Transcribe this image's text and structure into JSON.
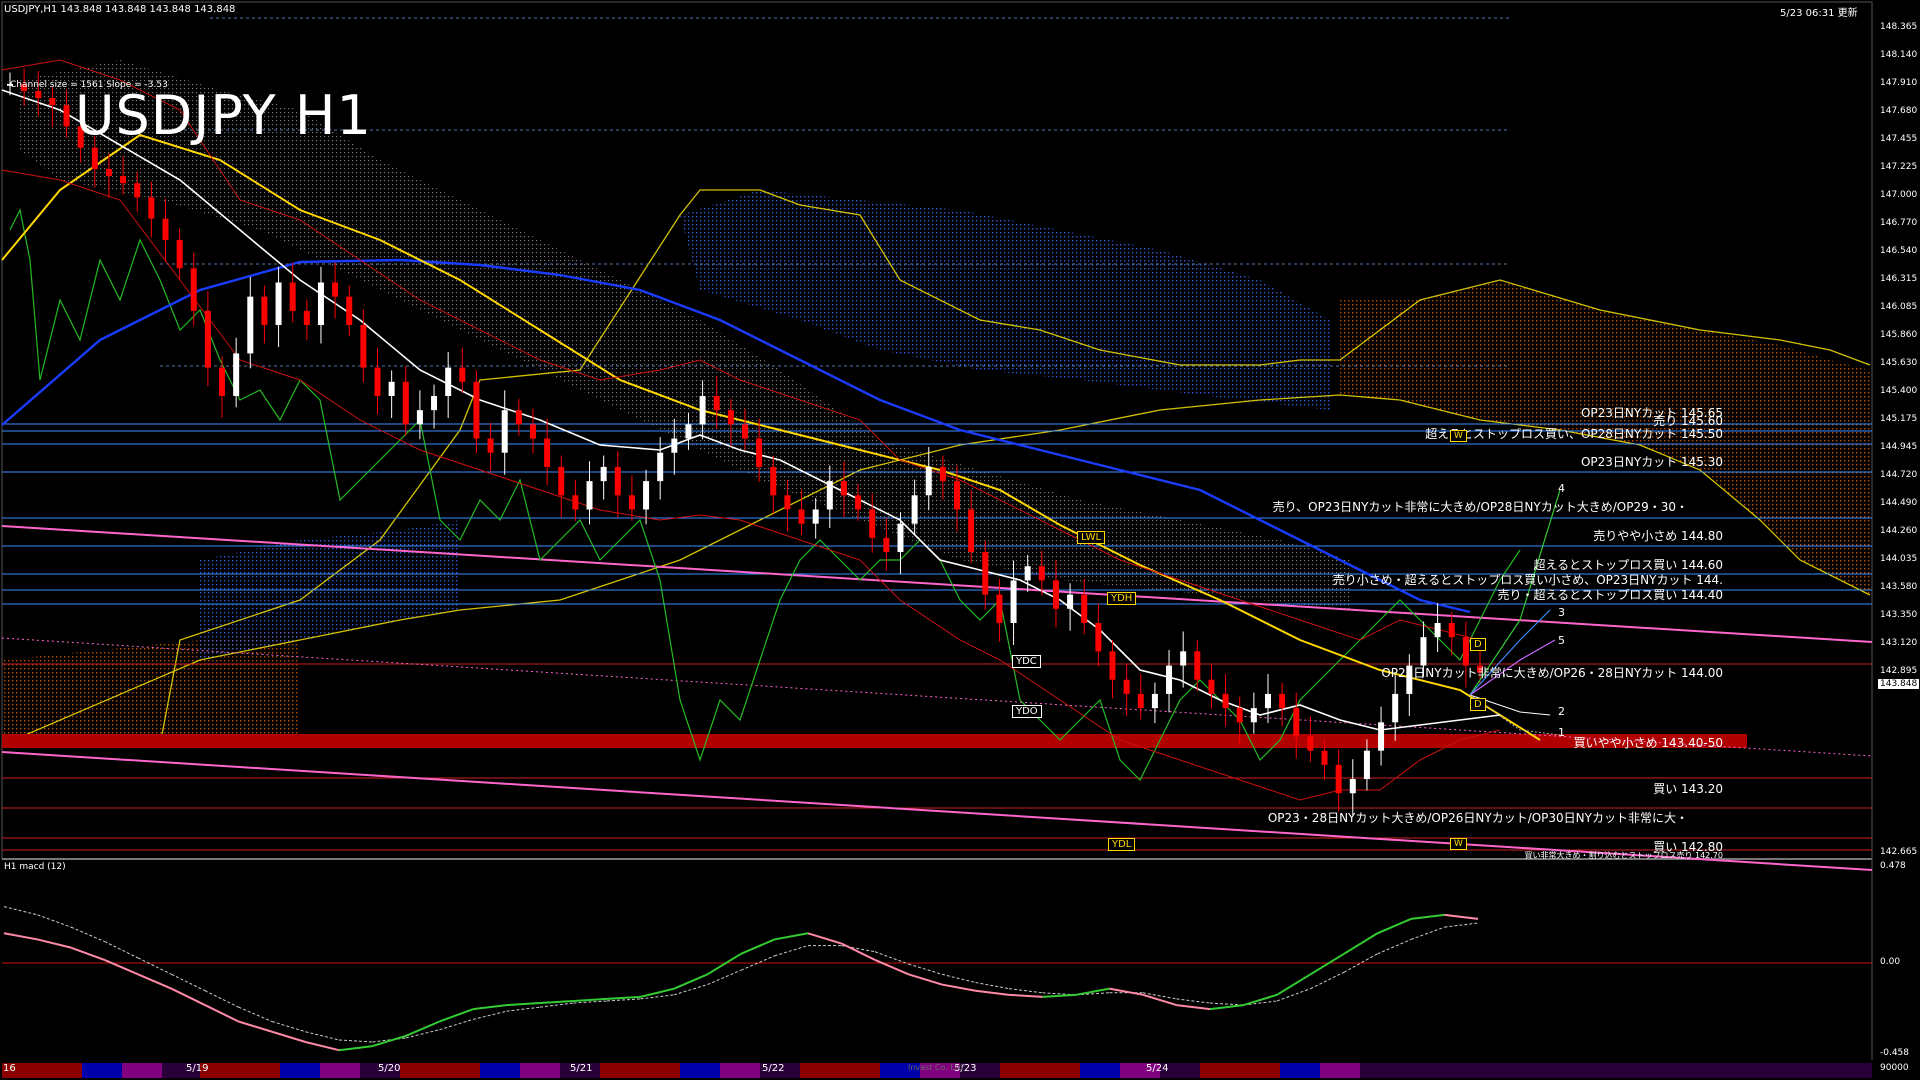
{
  "header": {
    "symbol_info": "USDJPY,H1  143.848 143.848 143.848 143.848",
    "channel_info": "Channel size = 1561 Slope = -3.53",
    "timestamp": "5/23 06:31 更新"
  },
  "title": "USDJPY H1",
  "price_scale": [
    "148.365",
    "148.140",
    "147.910",
    "147.680",
    "147.455",
    "147.225",
    "147.000",
    "146.770",
    "146.540",
    "146.315",
    "146.085",
    "145.860",
    "145.630",
    "145.400",
    "145.175",
    "144.945",
    "144.720",
    "144.490",
    "144.260",
    "144.035",
    "143.580",
    "143.350",
    "143.120",
    "142.895",
    "142.665"
  ],
  "current_price": "143.848",
  "order_labels": [
    "OP23日NYカット 145.65",
    "売り 145.60",
    "超えるとストップロス買い、OP28日NYカット 145.50",
    "OP23日NYカット 145.30",
    "売り、OP23日NYカット非常に大きめ/OP28日NYカット大きめ/OP29・30・",
    "売りやや小さめ 144.80",
    "超えるとストップロス買い 144.60",
    "売り小さめ・超えるとストップロス買い小さめ、OP23日NYカット 144.",
    "売り・超えるとストップロス買い 144.40",
    "OP23日NYカット非常に大きめ/OP26・28日NYカット 144.00",
    "買いやや小さめ 143.40-50",
    "買い 143.20",
    "OP23・28日NYカット大きめ/OP26日NYカット/OP30日NYカット非常に大・",
    "買い 142.80",
    "買い非常大きめ・割り込むとストップロス売り 142.70"
  ],
  "tags": {
    "lwl": "LWL",
    "ydh": "YDH",
    "ydc": "YDC",
    "ydo": "YDO",
    "ydl": "YDL",
    "w1": "W",
    "w2": "W",
    "d1": "D",
    "d2": "D"
  },
  "wave_labels": [
    "4",
    "3",
    "5",
    "2",
    "1"
  ],
  "macd": {
    "label": "H1  macd (12)",
    "scale": [
      "0.478",
      "0.00",
      "-0.458"
    ]
  },
  "date_axis": {
    "left_label": "16",
    "dates": [
      "5/19",
      "5/20",
      "5/21",
      "5/22",
      "5/23",
      "5/24"
    ],
    "right_label": "90000",
    "watermark": "Invast Co. Ltd"
  },
  "colors": {
    "bull_candle": "#ffffff",
    "bear_candle": "#ff0000",
    "ma_white": "#ffffff",
    "ma_yellow": "#ffd700",
    "ma_blue": "#1a3cff",
    "channel": "#ff66cc",
    "cloud_bull": "#4169e1",
    "cloud_bear": "#ff4500",
    "macd_line": "#33cc33",
    "signal_line": "#cccccc",
    "macd_neg": "#ff8aa8"
  },
  "chart_data": {
    "type": "candlestick",
    "title": "USDJPY H1",
    "ylim": [
      142.6,
      148.45
    ],
    "close_series": [
      148.0,
      147.95,
      147.9,
      147.85,
      147.7,
      147.55,
      147.4,
      147.35,
      147.3,
      147.2,
      147.05,
      146.9,
      146.7,
      146.4,
      146.0,
      145.8,
      146.1,
      146.5,
      146.3,
      146.6,
      146.4,
      146.3,
      146.6,
      146.5,
      146.3,
      146.0,
      145.8,
      145.9,
      145.6,
      145.7,
      145.8,
      146.0,
      145.9,
      145.5,
      145.4,
      145.7,
      145.6,
      145.5,
      145.3,
      145.1,
      145.0,
      145.2,
      145.3,
      145.1,
      145.0,
      145.2,
      145.4,
      145.5,
      145.6,
      145.8,
      145.7,
      145.6,
      145.5,
      145.3,
      145.1,
      145.0,
      144.9,
      145.0,
      145.2,
      145.1,
      145.0,
      144.8,
      144.7,
      144.9,
      145.1,
      145.3,
      145.2,
      145.0,
      144.7,
      144.4,
      144.2,
      144.5,
      144.6,
      144.5,
      144.3,
      144.4,
      144.2,
      144.0,
      143.8,
      143.7,
      143.6,
      143.7,
      143.9,
      144.0,
      143.8,
      143.7,
      143.6,
      143.5,
      143.6,
      143.7,
      143.6,
      143.4,
      143.3,
      143.2,
      143.0,
      143.1,
      143.3,
      143.5,
      143.7,
      143.9,
      144.1,
      144.2,
      144.1,
      143.9,
      143.85
    ],
    "macd_series": [
      0.15,
      0.12,
      0.08,
      0.02,
      -0.05,
      -0.12,
      -0.2,
      -0.28,
      -0.33,
      -0.38,
      -0.42,
      -0.4,
      -0.35,
      -0.28,
      -0.22,
      -0.2,
      -0.19,
      -0.18,
      -0.17,
      -0.16,
      -0.12,
      -0.05,
      0.05,
      0.12,
      0.15,
      0.1,
      0.02,
      -0.05,
      -0.1,
      -0.13,
      -0.15,
      -0.16,
      -0.15,
      -0.12,
      -0.15,
      -0.2,
      -0.22,
      -0.2,
      -0.15,
      -0.05,
      0.05,
      0.15,
      0.22,
      0.24,
      0.22
    ],
    "signal_series": [
      0.28,
      0.24,
      0.18,
      0.11,
      0.03,
      -0.05,
      -0.13,
      -0.21,
      -0.28,
      -0.33,
      -0.37,
      -0.38,
      -0.36,
      -0.32,
      -0.27,
      -0.23,
      -0.21,
      -0.19,
      -0.18,
      -0.17,
      -0.15,
      -0.1,
      -0.03,
      0.04,
      0.09,
      0.09,
      0.06,
      0.0,
      -0.05,
      -0.09,
      -0.12,
      -0.14,
      -0.15,
      -0.14,
      -0.14,
      -0.17,
      -0.19,
      -0.2,
      -0.18,
      -0.12,
      -0.04,
      0.05,
      0.12,
      0.18,
      0.2
    ],
    "levels": [
      145.65,
      145.6,
      145.5,
      145.3,
      145.05,
      144.8,
      144.6,
      144.5,
      144.4,
      144.0,
      143.45,
      143.2,
      142.95,
      142.8,
      142.7
    ]
  }
}
